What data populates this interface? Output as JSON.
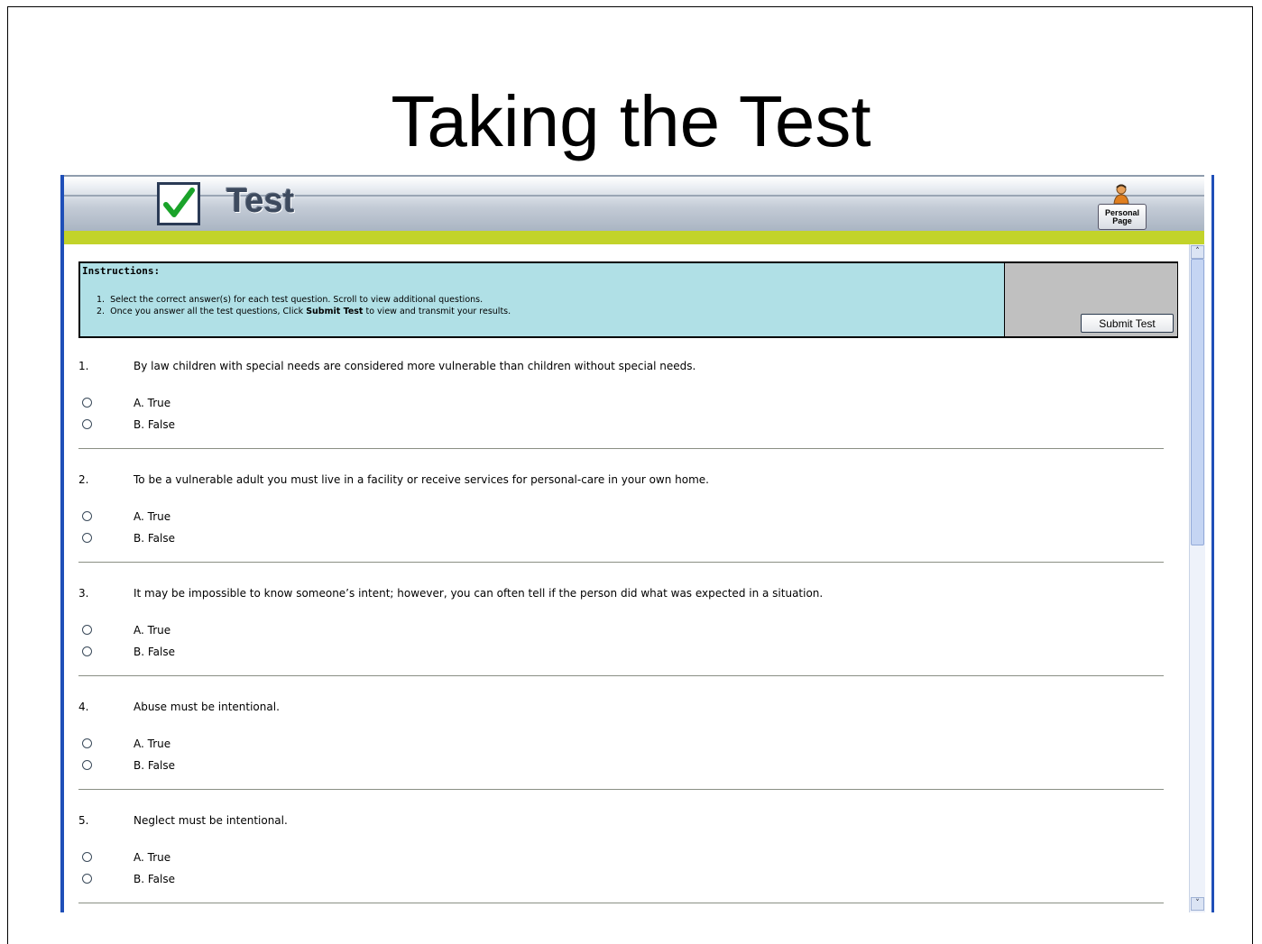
{
  "slide": {
    "title": "Taking the Test"
  },
  "header": {
    "app_name": "Test",
    "personal_page_line1": "Personal",
    "personal_page_line2": "Page"
  },
  "instructions": {
    "title": "Instructions:",
    "step1_num": "1.",
    "step1": "Select the correct answer(s) for each test question. Scroll to view additional questions.",
    "step2_num": "2.",
    "step2_pre": "Once you answer all the test questions, Click ",
    "step2_bold": "Submit Test",
    "step2_post": " to view and transmit your results.",
    "submit_label": "Submit Test"
  },
  "questions": [
    {
      "num": "1.",
      "text": "By law children with special needs are considered more vulnerable than children without special needs.",
      "options": [
        "A. True",
        "B. False"
      ]
    },
    {
      "num": "2.",
      "text": "To be a vulnerable adult you must live in a facility or receive services for personal-care in your own home.",
      "options": [
        "A. True",
        "B. False"
      ]
    },
    {
      "num": "3.",
      "text": "It may be impossible to know someone’s intent; however, you can often tell if the person did what was expected in a situation.",
      "options": [
        "A. True",
        "B. False"
      ]
    },
    {
      "num": "4.",
      "text": "Abuse must be intentional.",
      "options": [
        "A. True",
        "B. False"
      ]
    },
    {
      "num": "5.",
      "text": "Neglect must be intentional.",
      "options": [
        "A. True",
        "B. False"
      ]
    }
  ],
  "scrollbar": {
    "up_glyph": "˄",
    "down_glyph": "˅"
  },
  "colors": {
    "accent_green": "#c2d32a",
    "instructions_bg": "#b0e0e6",
    "frame_blue": "#1f4fb8"
  }
}
